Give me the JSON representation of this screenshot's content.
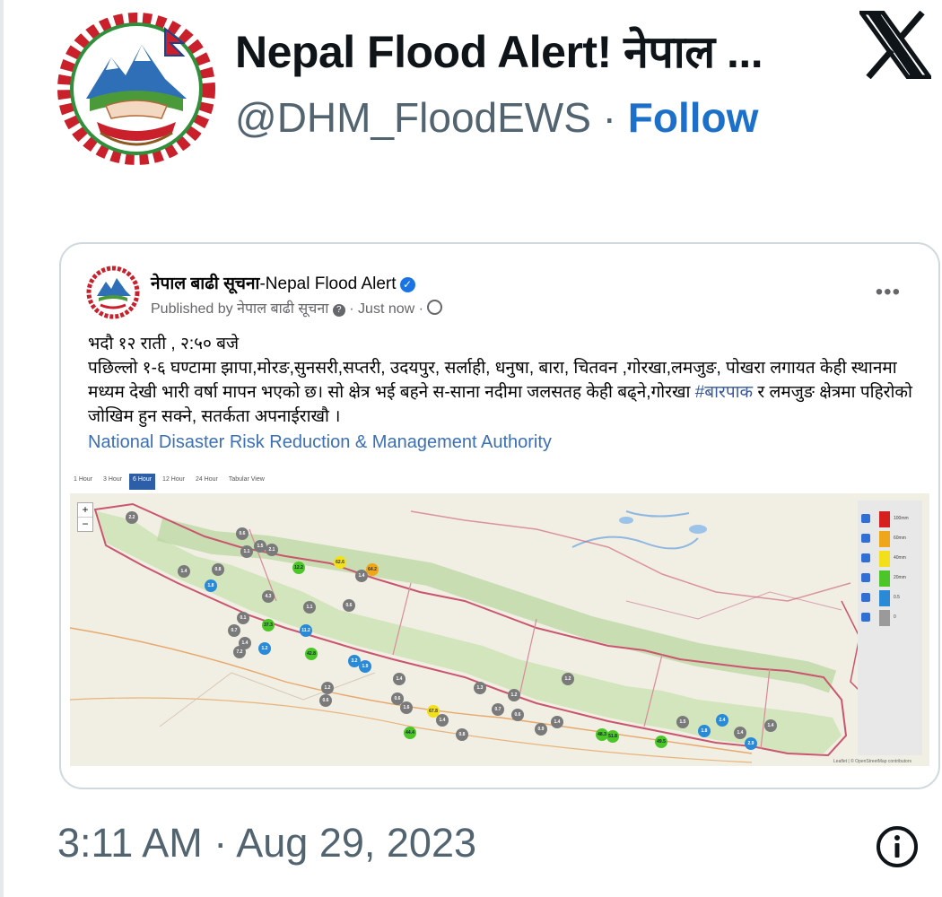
{
  "tweet": {
    "display_name": "Nepal Flood Alert! नेपाल ...",
    "handle": "@DHM_FloodEWS",
    "separator": "·",
    "follow_label": "Follow",
    "timestamp": "3:11 AM · Aug 29, 2023"
  },
  "embed": {
    "page_name": "नेपाल बाढी सूचना",
    "page_name_en": "-Nepal Flood Alert",
    "published_prefix": "Published by",
    "published_by": "नेपाल बाढी सूचना",
    "time": "· Just now ·",
    "body_line1": "भदौ १२ राती , २:५० बजे",
    "body_line2_a": "पछिल्लो १-६ घण्टामा झापा,मोरङ,सुनसरी,सप्तरी, उदयपुर, सर्लाही, धनुषा, बारा, चितवन ,गोरखा,लमजुङ, पोखरा लगायत केही स्थानमा मध्यम देखी भारी वर्षा मापन भएको छ। सो क्षेत्र भई बहने स-साना नदीमा जलसतह केही बढ्ने,गोरखा ",
    "hashtag": "#बारपाक",
    "body_line2_b": " र लमजुङ क्षेत्रमा पहिरोको जोखिम हुन सक्ने, सतर्कता अपनाईराखौ ।",
    "link": "National Disaster Risk Reduction & Management Authority"
  },
  "map": {
    "tabs": [
      "1 Hour",
      "3 Hour",
      "6 Hour",
      "12 Hour",
      "24 Hour",
      "Tabular View"
    ],
    "active_tab": "6 Hour",
    "zoom_in": "+",
    "zoom_out": "−",
    "legend": [
      {
        "label": "100mm",
        "color": "#d62020"
      },
      {
        "label": "60mm",
        "color": "#f0a61a"
      },
      {
        "label": "40mm",
        "color": "#f2e01c"
      },
      {
        "label": "20mm",
        "color": "#4cc528"
      },
      {
        "label": "0.5",
        "color": "#2a8ad6"
      },
      {
        "label": "0",
        "color": "#9a9a9a"
      }
    ],
    "attribution": "Leaflet | © OpenStreetMap contributors",
    "stations": [
      {
        "v": "2.2",
        "c": "gray"
      },
      {
        "v": "1.4",
        "c": "gray"
      },
      {
        "v": "0.8",
        "c": "gray"
      },
      {
        "v": "1.8",
        "c": "blue"
      },
      {
        "v": "0.6",
        "c": "gray"
      },
      {
        "v": "1.1",
        "c": "gray"
      },
      {
        "v": "1.5",
        "c": "gray"
      },
      {
        "v": "2.1",
        "c": "gray"
      },
      {
        "v": "12.2",
        "c": "green"
      },
      {
        "v": "62.6",
        "c": "yellow"
      },
      {
        "v": "1.4",
        "c": "gray"
      },
      {
        "v": "64.2",
        "c": "orange"
      },
      {
        "v": "0.6",
        "c": "gray"
      },
      {
        "v": "4.3",
        "c": "gray"
      },
      {
        "v": "0.1",
        "c": "gray"
      },
      {
        "v": "0.7",
        "c": "gray"
      },
      {
        "v": "1.4",
        "c": "gray"
      },
      {
        "v": "7.2",
        "c": "gray"
      },
      {
        "v": "1.2",
        "c": "blue"
      },
      {
        "v": "37.3",
        "c": "green"
      },
      {
        "v": "1.1",
        "c": "gray"
      },
      {
        "v": "11.2",
        "c": "blue"
      },
      {
        "v": "42.8",
        "c": "green"
      },
      {
        "v": "1.2",
        "c": "gray"
      },
      {
        "v": "0.6",
        "c": "gray"
      },
      {
        "v": "3.2",
        "c": "blue"
      },
      {
        "v": "1.9",
        "c": "blue"
      },
      {
        "v": "1.4",
        "c": "gray"
      },
      {
        "v": "0.6",
        "c": "gray"
      },
      {
        "v": "1.6",
        "c": "gray"
      },
      {
        "v": "67.8",
        "c": "yellow"
      },
      {
        "v": "44.4",
        "c": "green"
      },
      {
        "v": "1.4",
        "c": "gray"
      },
      {
        "v": "0.8",
        "c": "gray"
      },
      {
        "v": "1.3",
        "c": "gray"
      },
      {
        "v": "1.2",
        "c": "gray"
      },
      {
        "v": "0.7",
        "c": "gray"
      },
      {
        "v": "0.6",
        "c": "gray"
      },
      {
        "v": "0.9",
        "c": "gray"
      },
      {
        "v": "1.4",
        "c": "gray"
      },
      {
        "v": "1.2",
        "c": "gray"
      },
      {
        "v": "48.3",
        "c": "green"
      },
      {
        "v": "51.8",
        "c": "green"
      },
      {
        "v": "49.5",
        "c": "green"
      },
      {
        "v": "1.5",
        "c": "gray"
      },
      {
        "v": "1.8",
        "c": "blue"
      },
      {
        "v": "2.4",
        "c": "blue"
      },
      {
        "v": "1.4",
        "c": "gray"
      },
      {
        "v": "2.9",
        "c": "blue"
      },
      {
        "v": "1.4",
        "c": "gray"
      }
    ]
  },
  "icons": {
    "x_logo": "x-logo-icon",
    "info": "info-icon",
    "verified": "verified-badge-icon",
    "globe": "globe-icon"
  }
}
